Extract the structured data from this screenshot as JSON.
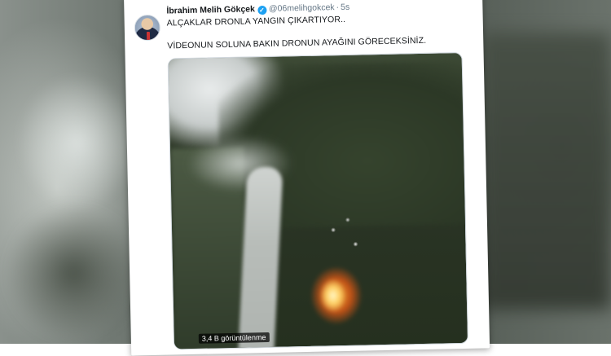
{
  "tweet": {
    "display_name": "İbrahim Melih Gökçek",
    "verified_mark": "✓",
    "handle": "@06melihgokcek",
    "separator": "·",
    "time": "5s",
    "text_line_1": "ALÇAKLAR DRONLA YANGIN ÇIKARTIYOR..",
    "text_line_2": "VİDEONUN SOLUNA BAKIN DRONUN AYAĞINI GÖRECEKSİNİZ.",
    "video": {
      "view_count": "3,4 B görüntülenme"
    }
  },
  "icons": {
    "verified": "verified-badge-icon",
    "avatar": "profile-photo"
  },
  "colors": {
    "verified": "#1da1f2",
    "handle": "#657786",
    "text": "#14171a"
  }
}
